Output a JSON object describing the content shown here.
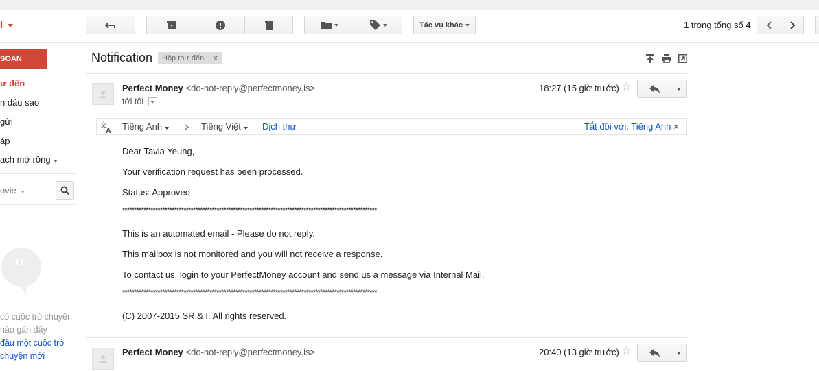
{
  "toolbar": {
    "more_actions_label": "Tác vụ khác",
    "pager": {
      "current": "1",
      "middle": " trong tổng số ",
      "total": "4"
    }
  },
  "sidebar": {
    "brand_fragment": "l",
    "compose_label": "SOẠN",
    "items": [
      {
        "label": "ư đến"
      },
      {
        "label": "n dấu sao"
      },
      {
        "label": "gửi"
      },
      {
        "label": "áp"
      },
      {
        "label": "ach mở rộng"
      }
    ],
    "search_label": "ovie",
    "hangouts": {
      "line1": "có cuộc trò chuyện",
      "line2": "nào gần đây",
      "link1": "đầu một cuộc trò",
      "link2": "chuyện mới"
    }
  },
  "thread": {
    "subject": "Notification",
    "label_tag": "Hộp thư đến",
    "label_close": "x"
  },
  "message1": {
    "sender_name": "Perfect Money",
    "sender_email": "<do-not-reply@perfectmoney.is>",
    "to_line": "tới tôi",
    "time": "18:27 (15 giờ trước)"
  },
  "translate": {
    "from_lang": "Tiếng Anh",
    "to_lang": "Tiếng Việt",
    "translate_link": "Dịch thư",
    "turn_off": "Tắt đối với: Tiếng Anh"
  },
  "body": {
    "greeting": "Dear Tavia Yeung,",
    "line1": "Your verification request has been processed.",
    "status": "Status: Approved",
    "separator": "************************************************************************************************************",
    "auto_note": "This is an automated email - Please do not reply.",
    "not_monitored": "This mailbox is not monitored and you will not receive a response.",
    "contact": "To contact us, login to your PerfectMoney account and send us a message via Internal Mail.",
    "copyright": "(C) 2007-2015 SR & I. All rights reserved."
  },
  "message2": {
    "sender_name": "Perfect Money",
    "sender_email": "<do-not-reply@perfectmoney.is>",
    "time": "20:40 (13 giờ trước)"
  },
  "colors": {
    "compose": "#d14836",
    "link": "#1155cc",
    "border": "#d6d6d6"
  }
}
